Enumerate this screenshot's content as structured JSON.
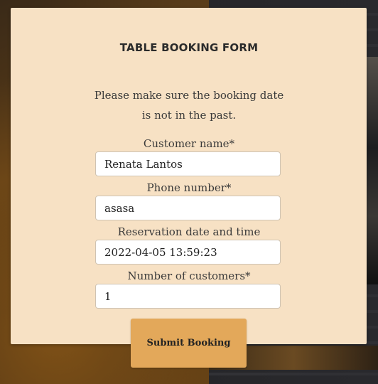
{
  "form": {
    "title": "TABLE BOOKING FORM",
    "notice_line1": "Please make sure the booking date",
    "notice_line2": "is not in the past.",
    "fields": [
      {
        "label": "Customer name*",
        "value": "Renata Lantos"
      },
      {
        "label": "Phone number*",
        "value": "asasa"
      },
      {
        "label": "Reservation date and time",
        "value": "2022-04-05 13:59:23"
      },
      {
        "label": "Number of customers*",
        "value": "1"
      }
    ],
    "submit_label": "Submit Booking"
  },
  "colors": {
    "card_background": "#f7e1c4",
    "submit_button": "#e3a85a",
    "text": "#3a3a3a"
  }
}
